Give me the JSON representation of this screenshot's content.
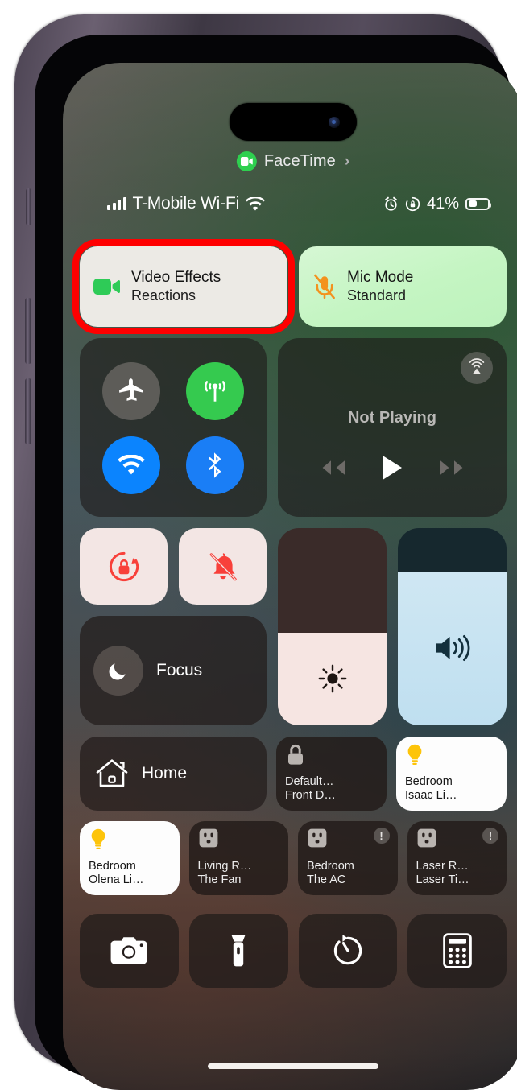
{
  "device": {
    "name": "iphone-14-pro",
    "frame_color": "#4b4352"
  },
  "dynamic_island": {
    "camera": "front-camera"
  },
  "facetime_banner": {
    "label": "FaceTime",
    "chevron": "›",
    "icon": "video-camera-icon",
    "icon_color": "#2ed04f"
  },
  "status_bar": {
    "signal_icon": "cellular-bars-icon",
    "carrier": "T-Mobile Wi-Fi",
    "wifi_icon": "wifi-icon",
    "alarm_icon": "alarm-clock-icon",
    "rotation_lock_icon": "rotation-lock-icon",
    "battery_percent": "41%",
    "battery_icon": "battery-icon"
  },
  "effects_row": {
    "video_effects": {
      "title": "Video Effects",
      "subtitle": "Reactions",
      "icon": "video-camera-icon",
      "icon_color": "#2ecb57",
      "background": "#eceae5",
      "highlighted": true,
      "highlight_color": "#fe0000"
    },
    "mic_mode": {
      "title": "Mic Mode",
      "subtitle": "Standard",
      "icon": "mic-muted-icon",
      "icon_color": "#f3921e",
      "background": "#c4f5c2"
    }
  },
  "connectivity": {
    "airplane_mode": {
      "name": "Airplane Mode",
      "icon": "airplane-icon",
      "on": false,
      "color": "#706e6a"
    },
    "cellular_data": {
      "name": "Cellular Data",
      "icon": "cellular-antenna-icon",
      "on": true,
      "color": "#35ca4f"
    },
    "wifi": {
      "name": "Wi-Fi",
      "icon": "wifi-icon",
      "on": true,
      "color": "#0b84fe"
    },
    "bluetooth": {
      "name": "Bluetooth",
      "icon": "bluetooth-icon",
      "on": true,
      "color": "#1a7ef6"
    }
  },
  "media_player": {
    "status": "Not Playing",
    "airplay_icon": "airplay-audio-icon",
    "rewind_icon": "rewind-icon",
    "play_icon": "play-icon",
    "forward_icon": "fast-forward-icon"
  },
  "toggles": {
    "rotation_lock": {
      "name": "Portrait Orientation Lock",
      "icon": "rotation-lock-icon",
      "active": true,
      "icon_color": "#f8403a",
      "background": "#f3e6e4"
    },
    "silent_mode": {
      "name": "Silent Mode",
      "icon": "bell-slash-icon",
      "active": true,
      "icon_color": "#f8403a",
      "background": "#f3e6e4"
    },
    "focus": {
      "label": "Focus",
      "icon": "moon-icon"
    }
  },
  "sliders": {
    "brightness": {
      "name": "Brightness",
      "icon": "sun-icon",
      "value_percent": 47,
      "fill_color": "#f6e5e2"
    },
    "volume": {
      "name": "Volume",
      "icon": "speaker-waves-icon",
      "value_percent": 78,
      "fill_color": "#cfe7f3"
    }
  },
  "home_row": {
    "home": {
      "label": "Home",
      "icon": "home-icon"
    },
    "accessories": [
      {
        "line1": "Default…",
        "line2": "Front D…",
        "icon": "lock-icon",
        "state": "off",
        "warning": false
      },
      {
        "line1": "Bedroom",
        "line2": "Isaac Li…",
        "icon": "lightbulb-icon",
        "state": "on",
        "warning": false
      }
    ]
  },
  "accessory_row": [
    {
      "line1": "Bedroom",
      "line2": "Olena Li…",
      "icon": "lightbulb-icon",
      "state": "on",
      "warning": false
    },
    {
      "line1": "Living R…",
      "line2": "The Fan",
      "icon": "outlet-icon",
      "state": "off",
      "warning": false
    },
    {
      "line1": "Bedroom",
      "line2": "The AC",
      "icon": "outlet-icon",
      "state": "off",
      "warning": true
    },
    {
      "line1": "Laser R…",
      "line2": "Laser Ti…",
      "icon": "outlet-icon",
      "state": "off",
      "warning": true
    }
  ],
  "utility_row": [
    {
      "name": "Camera",
      "icon": "camera-icon"
    },
    {
      "name": "Flashlight",
      "icon": "flashlight-icon"
    },
    {
      "name": "Timer",
      "icon": "timer-icon"
    },
    {
      "name": "Calculator",
      "icon": "calculator-icon"
    }
  ],
  "home_indicator": {
    "name": "home-indicator"
  }
}
